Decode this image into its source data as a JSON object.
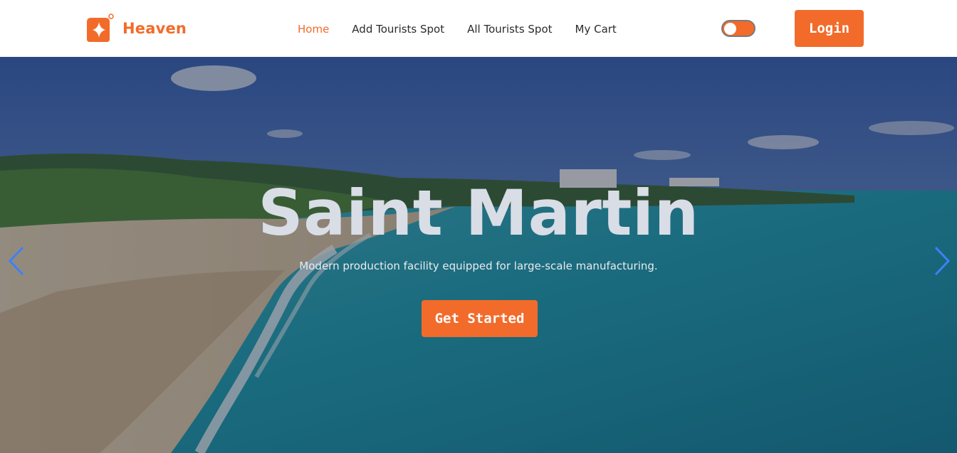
{
  "brand": {
    "name": "Heaven",
    "logo_icon": "sparkle-star-icon",
    "color": "#f26b2a"
  },
  "nav": {
    "links": [
      {
        "label": "Home",
        "active": true
      },
      {
        "label": "Add Tourists Spot",
        "active": false
      },
      {
        "label": "All Tourists Spot",
        "active": false
      },
      {
        "label": "My Cart",
        "active": false
      }
    ],
    "theme_toggle": {
      "state": "off",
      "icon": "toggle-switch-icon"
    },
    "login_label": "Login"
  },
  "hero": {
    "title": "Saint Martin",
    "subtitle": "Modern production facility equipped for large-scale manufacturing.",
    "cta_label": "Get Started",
    "prev_icon": "chevron-left-icon",
    "next_icon": "chevron-right-icon",
    "arrow_color": "#3b82f6"
  },
  "colors": {
    "accent": "#f26b2a",
    "text": "#2b2b2b",
    "hero_text": "#d9dde6"
  }
}
